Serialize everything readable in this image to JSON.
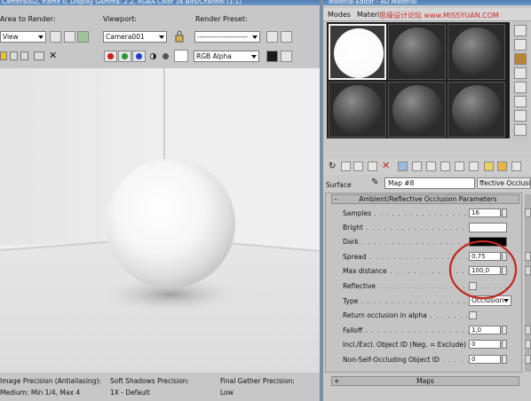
{
  "render_window": {
    "title": "Camera002, frame 0, Display Gamma: 2.2, RGBA Color 16 Bits/Channel (1:1)",
    "area_label": "Area to Render:",
    "area_value": "View",
    "viewport_label": "Viewport:",
    "viewport_value": "Camera001",
    "preset_label": "Render Preset:",
    "preset_value": "---------------------",
    "channel_value": "RGB Alpha",
    "footer": {
      "image_precision_label": "Image Precision (Antialiasing):",
      "image_precision_value": "Medium: Min 1/4, Max 4",
      "soft_shadows_label": "Soft Shadows Precision:",
      "soft_shadows_value": "1X - Default",
      "final_gather_label": "Final Gather Precision:",
      "final_gather_value": "Low"
    }
  },
  "material_editor": {
    "title": "Material Editor - AO Material",
    "menu": [
      "Modes",
      "Materi"
    ],
    "watermark": "思缘设计论坛 www.MISSYUAN.COM",
    "surface_label": "Surface",
    "map_name": "Map #8",
    "map_type": "ffective Occlusion",
    "rollout_title": "Ambient/Reflective Occlusion Parameters",
    "params": {
      "samples_label": "Samples",
      "samples_value": "16",
      "bright_label": "Bright",
      "dark_label": "Dark",
      "spread_label": "Spread",
      "spread_value": "0,75",
      "max_distance_label": "Max distance",
      "max_distance_value": "100,0",
      "reflective_label": "Reflective",
      "type_label": "Type",
      "type_value": "Occlusion",
      "return_label": "Return occlusion in alpha",
      "falloff_label": "Falloff",
      "falloff_value": "1,0",
      "incl_excl_label": "Incl./Excl. Object ID (Neg. = Exclude)",
      "incl_excl_value": "0",
      "non_self_label": "Non-Self-Occluding Object ID",
      "non_self_value": "0"
    },
    "maps_rollout_title": "Maps"
  },
  "colors": {
    "highlight_circle": "#c0281e",
    "title_bar": "#5a86bb"
  }
}
